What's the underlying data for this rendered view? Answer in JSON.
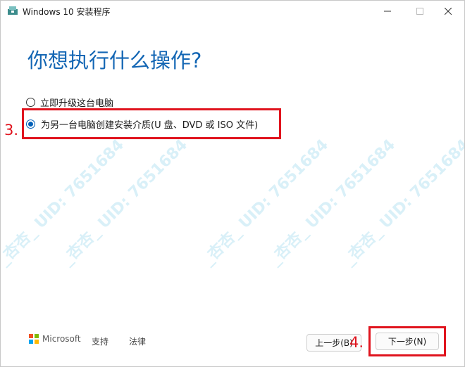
{
  "window": {
    "title": "Windows 10 安装程序"
  },
  "main": {
    "heading": "你想执行什么操作?",
    "options": [
      {
        "label": "立即升级这台电脑",
        "selected": false
      },
      {
        "label": "为另一台电脑创建安装介质(U 盘、DVD 或 ISO 文件)",
        "selected": true
      }
    ]
  },
  "annotations": {
    "step3": "3.",
    "step4": "4."
  },
  "watermark": {
    "text": "_杏杏_ UID: 7651684"
  },
  "footer": {
    "brand": "Microsoft",
    "support_link": "支持",
    "legal_link": "法律",
    "back_button": "上一步(B)",
    "next_button": "下一步(N)"
  },
  "colors": {
    "accent": "#1366b4",
    "radio_selected": "#005fb8",
    "annotation_red": "#e0141e",
    "ms_red": "#f25022",
    "ms_green": "#7fba00",
    "ms_blue": "#00a4ef",
    "ms_yellow": "#ffb900"
  }
}
